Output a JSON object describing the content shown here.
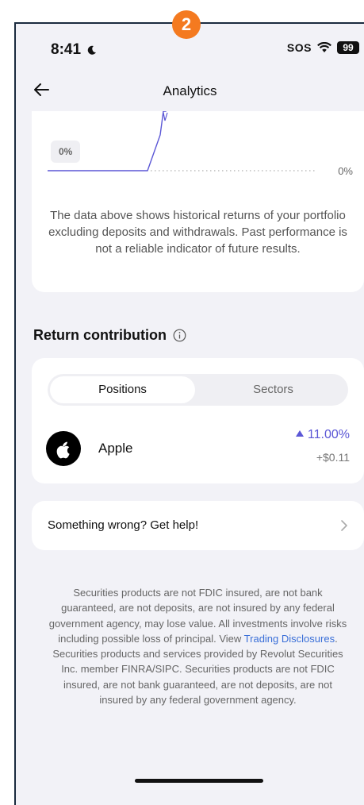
{
  "step_badge": "2",
  "status_bar": {
    "time": "8:41",
    "carrier": "SOS",
    "battery": "99"
  },
  "header": {
    "title": "Analytics"
  },
  "chart_section": {
    "start_chip": "0%",
    "end_label": "0%",
    "disclaimer": "The data above shows historical returns of your portfolio excluding deposits and withdrawals. Past performance is not a reliable indicator of future results."
  },
  "return_contribution": {
    "title": "Return contribution",
    "tabs": [
      {
        "label": "Positions",
        "selected": true
      },
      {
        "label": "Sectors",
        "selected": false
      }
    ],
    "positions": [
      {
        "name": "Apple",
        "change": "11.00%",
        "change_value": "+$0.11",
        "icon": "apple-logo"
      }
    ]
  },
  "help": {
    "label": "Something wrong? Get help!"
  },
  "legal": {
    "part1": "Securities products are not FDIC insured, are not bank guaranteed, are not deposits, are not insured by any federal government agency, may lose value. All investments involve risks including possible loss of principal. View ",
    "link": "Trading Disclosures",
    "part2": ".",
    "part3": "Securities products and services provided by Revolut Securities Inc. member FINRA/SIPC. Securities products are not FDIC insured, are not bank guaranteed, are not deposits, are not insured by any federal government agency."
  },
  "colors": {
    "accent": "#5b57d6",
    "badge": "#f47a20",
    "link": "#3a6fd8"
  }
}
